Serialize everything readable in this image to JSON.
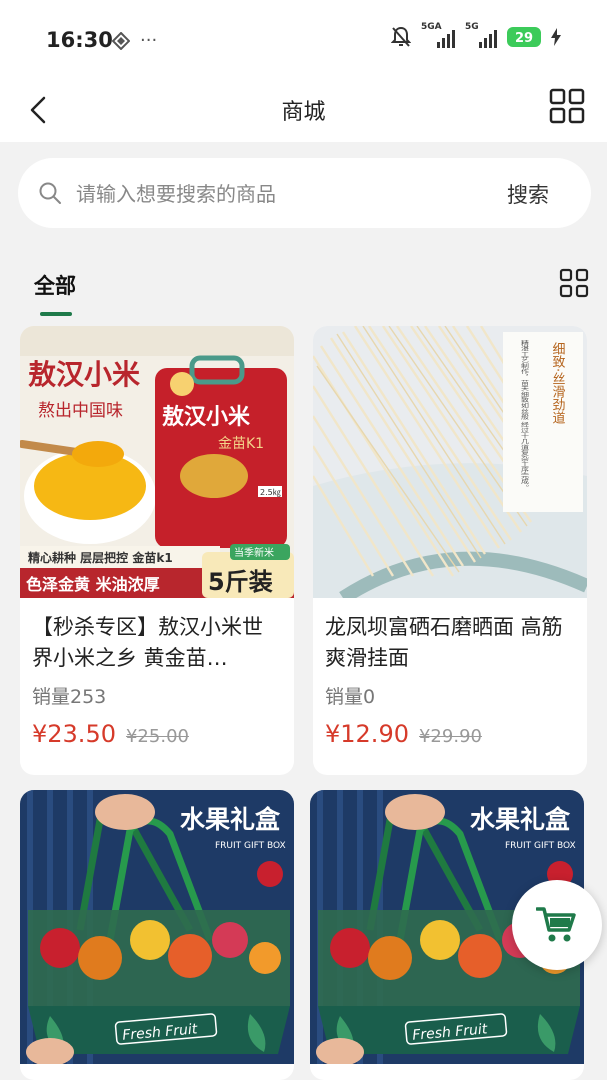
{
  "status": {
    "time": "16:30",
    "net1": "5GA",
    "net2": "5G",
    "battery": "29"
  },
  "nav": {
    "title": "商城"
  },
  "search": {
    "placeholder": "请输入想要搜索的商品",
    "button": "搜索"
  },
  "tabs": {
    "all": "全部"
  },
  "products": [
    {
      "title": "【秒杀专区】敖汉小米世界小米之乡 黄金苗…",
      "sales": "销量253",
      "price": "¥23.50",
      "old_price": "¥25.00",
      "img": {
        "brand": "敖汉小米",
        "slogan": "熬出中国味",
        "bag_title": "敖汉小米",
        "bag_sub": "金苗K1",
        "bag_weight": "2.5㎏",
        "strip1": "精心耕种 层层把控 金苗k1",
        "strip2": "色泽金黄 米油浓厚",
        "badge_top": "当季新米",
        "badge": "5斤装"
      }
    },
    {
      "title": "龙凤坝富硒石磨晒面 高筋爽滑挂面",
      "sales": "销量0",
      "price": "¥12.90",
      "old_price": "¥29.90",
      "img": {
        "tag": "细致·丝滑劲道",
        "note": "精湛工艺制作，苗天细致如丝般 经过十几道复杂工序完成。"
      }
    },
    {
      "img": {
        "title": "水果礼盒",
        "subtitle": "FRUIT GIFT BOX",
        "box_label": "Fresh Fruit"
      }
    },
    {
      "img": {
        "title": "水果礼盒",
        "subtitle": "FRUIT GIFT BOX",
        "box_label": "Fresh Fruit"
      }
    }
  ],
  "colors": {
    "accent_green": "#1f7a4a",
    "price_red": "#d63a2a"
  }
}
